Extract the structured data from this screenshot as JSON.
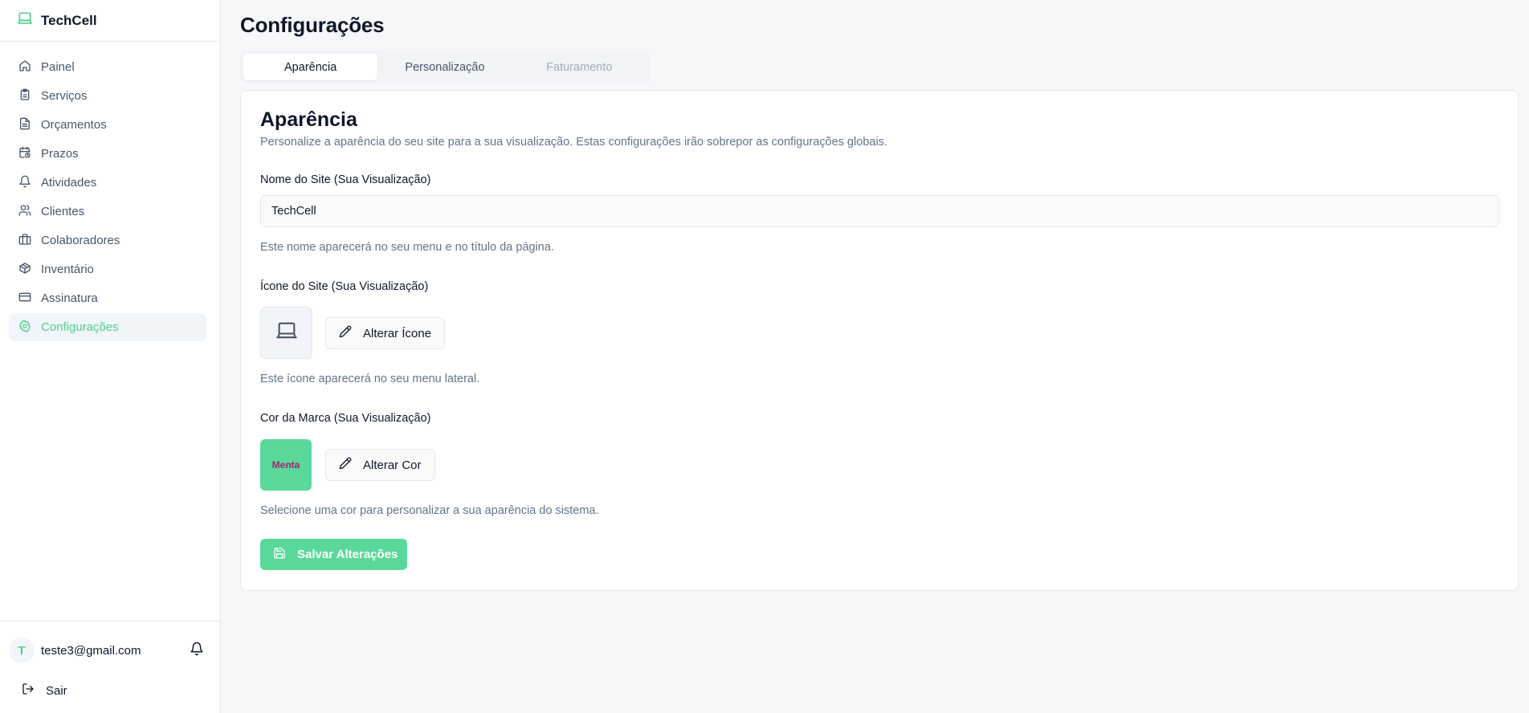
{
  "colors": {
    "accent": "#4fd08f",
    "brand_swatch": "#5ad89a",
    "swatch_text": "#a0266f"
  },
  "sidebar": {
    "brand": {
      "icon": "laptop-icon",
      "name": "TechCell"
    },
    "items": [
      {
        "icon": "home-icon",
        "label": "Painel"
      },
      {
        "icon": "clipboard-icon",
        "label": "Serviços"
      },
      {
        "icon": "file-text-icon",
        "label": "Orçamentos"
      },
      {
        "icon": "calendar-clock-icon",
        "label": "Prazos"
      },
      {
        "icon": "bell-icon",
        "label": "Atividades"
      },
      {
        "icon": "users-icon",
        "label": "Clientes"
      },
      {
        "icon": "briefcase-icon",
        "label": "Colaboradores"
      },
      {
        "icon": "package-icon",
        "label": "Inventário"
      },
      {
        "icon": "credit-card-icon",
        "label": "Assinatura"
      },
      {
        "icon": "gear-icon",
        "label": "Configurações",
        "active": true
      }
    ],
    "user": {
      "initial": "T",
      "email": "teste3@gmail.com"
    },
    "logout_label": "Sair"
  },
  "main": {
    "title": "Configurações",
    "tabs": [
      {
        "label": "Aparência",
        "active": true
      },
      {
        "label": "Personalização"
      },
      {
        "label": "Faturamento",
        "disabled": true
      }
    ],
    "card": {
      "title": "Aparência",
      "description": "Personalize a aparência do seu site para a sua visualização. Estas configurações irão sobrepor as configurações globais.",
      "site_name": {
        "label": "Nome do Site (Sua Visualização)",
        "value": "TechCell",
        "help": "Este nome aparecerá no seu menu e no título da página."
      },
      "site_icon": {
        "label": "Ícone do Site (Sua Visualização)",
        "button_label": "Alterar Ícone",
        "help": "Este ícone aparecerá no seu menu lateral."
      },
      "brand_color": {
        "label": "Cor da Marca (Sua Visualização)",
        "swatch_label": "Menta",
        "button_label": "Alterar Cor",
        "help": "Selecione uma cor para personalizar a sua aparência do sistema."
      },
      "save_label": "Salvar Alterações"
    }
  }
}
